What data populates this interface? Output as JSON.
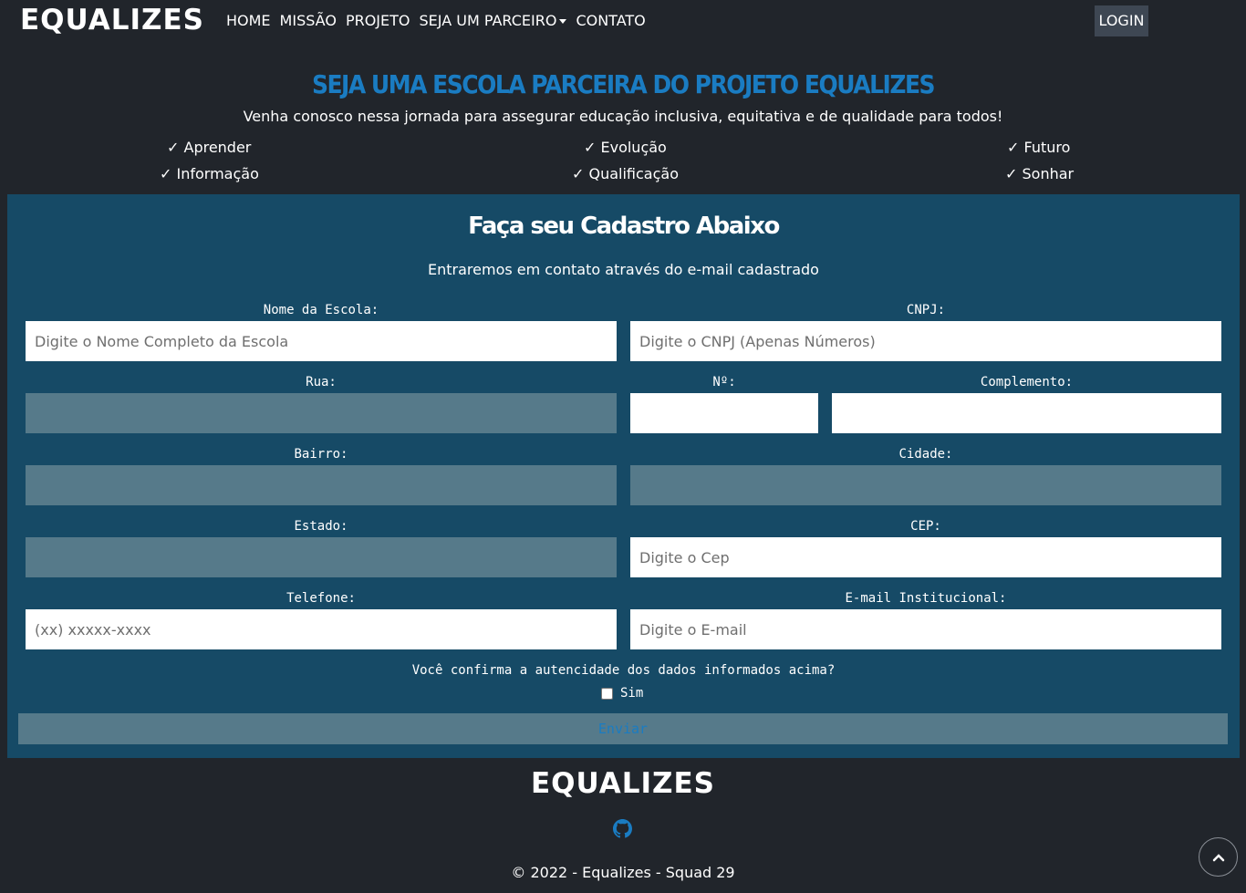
{
  "brand": "EQUALIZES",
  "nav": {
    "items": [
      "HOME",
      "MISSÃO",
      "PROJETO",
      "SEJA UM PARCEIRO",
      "CONTATO"
    ],
    "login": "LOGIN"
  },
  "hero": {
    "title": "SEJA UMA ESCOLA PARCEIRA DO PROJETO EQUALIZES",
    "subtitle": "Venha conosco nessa jornada para assegurar educação inclusiva, equitativa e de qualidade para todos!",
    "features": [
      "✓ Aprender",
      "✓ Evolução",
      "✓ Futuro",
      "✓ Informação",
      "✓ Qualificação",
      "✓ Sonhar"
    ]
  },
  "form": {
    "title": "Faça seu Cadastro Abaixo",
    "subtitle": "Entraremos em contato através do e-mail cadastrado",
    "fields": {
      "nome": {
        "label": "Nome da Escola:",
        "placeholder": "Digite o Nome Completo da Escola",
        "value": ""
      },
      "cnpj": {
        "label": "CNPJ:",
        "placeholder": "Digite o CNPJ (Apenas Números)",
        "value": ""
      },
      "rua": {
        "label": "Rua:",
        "placeholder": "",
        "value": ""
      },
      "numero": {
        "label": "Nº:",
        "placeholder": "",
        "value": ""
      },
      "complemento": {
        "label": "Complemento:",
        "placeholder": "",
        "value": ""
      },
      "bairro": {
        "label": "Bairro:",
        "placeholder": "",
        "value": ""
      },
      "cidade": {
        "label": "Cidade:",
        "placeholder": "",
        "value": ""
      },
      "estado": {
        "label": "Estado:",
        "placeholder": "",
        "value": ""
      },
      "cep": {
        "label": "CEP:",
        "placeholder": "Digite o Cep",
        "value": ""
      },
      "telefone": {
        "label": "Telefone:",
        "placeholder": "(xx) xxxxx-xxxx",
        "value": ""
      },
      "email": {
        "label": "E-mail Institucional:",
        "placeholder": "Digite o E-mail",
        "value": ""
      }
    },
    "confirm_question": "Você confirma a autencidade dos dados informados acima?",
    "confirm_option": "Sim",
    "confirm_checked": false,
    "submit": "Enviar"
  },
  "footer": {
    "logo": "EQUALIZES",
    "github_icon": "github-icon",
    "copyright": "© 2022 - Equalizes - Squad 29"
  },
  "colors": {
    "background": "#21252b",
    "accent": "#1a7cc2",
    "form_bg": "#164a66",
    "disabled_input": "#567a8a"
  }
}
